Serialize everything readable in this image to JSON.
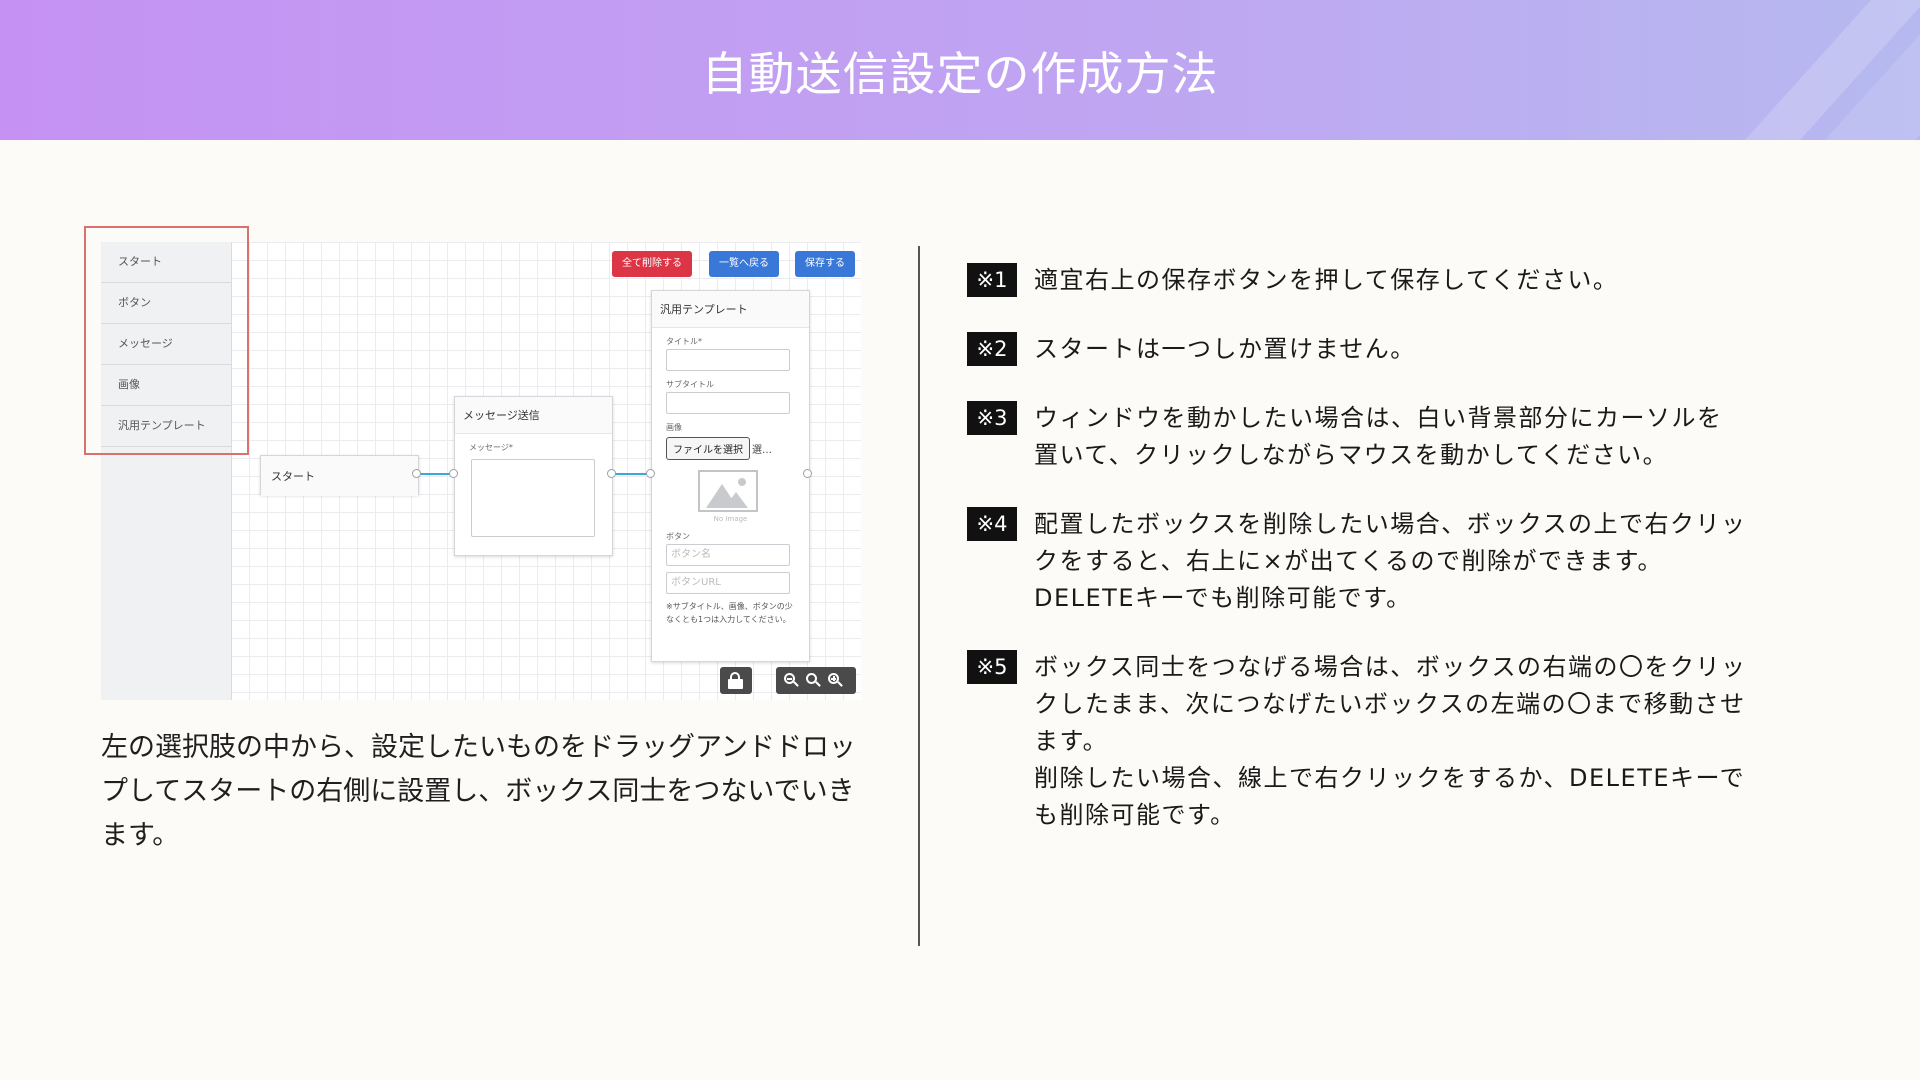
{
  "header": {
    "title": "自動送信設定の作成方法"
  },
  "screenshot": {
    "palette_items": [
      "スタート",
      "ボタン",
      "メッセージ",
      "画像",
      "汎用テンプレート"
    ],
    "toolbar": {
      "delete_all": "全て削除する",
      "back_to_list": "一覧へ戻る",
      "save": "保存する"
    },
    "start_node": {
      "title": "スタート"
    },
    "message_node": {
      "title": "メッセージ送信",
      "message_label": "メッセージ*"
    },
    "template_node": {
      "title": "汎用テンプレート",
      "title_label": "タイトル*",
      "subtitle_label": "サブタイトル",
      "image_label": "画像",
      "file_button": "ファイルを選択",
      "file_status": "選…",
      "no_image": "No Image",
      "button_label": "ボタン",
      "button_name_placeholder": "ボタン名",
      "button_url_placeholder": "ボタンURL",
      "note": "※サブタイトル、画像、ボタンの少なくとも1つは入力してください。"
    }
  },
  "description": "左の選択肢の中から、設定したいものをドラッグアンドドロップしてスタートの右側に設置し、ボックス同士をつないでいきます。",
  "notes": [
    {
      "badge": "※1",
      "lines": [
        "適宜右上の保存ボタンを押して保存してください。"
      ]
    },
    {
      "badge": "※2",
      "lines": [
        "スタートは一つしか置けません。"
      ]
    },
    {
      "badge": "※3",
      "lines": [
        "ウィンドウを動かしたい場合は、白い背景部分にカーソルを",
        "置いて、クリックしながらマウスを動かしてください。"
      ]
    },
    {
      "badge": "※4",
      "lines": [
        "配置したボックスを削除したい場合、ボックスの上で右クリッ",
        "クをすると、右上に×が出てくるので削除ができます。",
        "DELETEキーでも削除可能です。"
      ]
    },
    {
      "badge": "※5",
      "lines": [
        "ボックス同士をつなげる場合は、ボックスの右端の〇をクリッ",
        "クしたまま、次につなげたいボックスの左端の〇まで移動させ",
        "ます。",
        "削除したい場合、線上で右クリックをするか、DELETEキーで",
        "も削除可能です。"
      ]
    }
  ],
  "colors": {
    "header_gradient_start": "#c592f3",
    "header_gradient_end": "#b6b9f0",
    "highlight": "#d9726f",
    "danger": "#dc3545",
    "primary": "#3a78d8",
    "wire": "#3aa8cf"
  }
}
